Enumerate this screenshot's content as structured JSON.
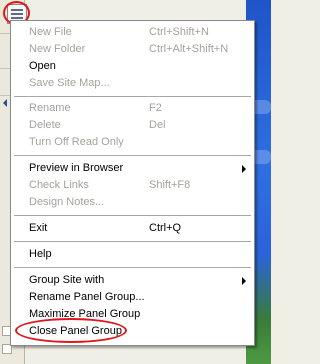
{
  "menu": {
    "items": [
      {
        "label": "New File",
        "shortcut": "Ctrl+Shift+N",
        "enabled": false,
        "submenu": false
      },
      {
        "label": "New Folder",
        "shortcut": "Ctrl+Alt+Shift+N",
        "enabled": false,
        "submenu": false
      },
      {
        "label": "Open",
        "shortcut": "",
        "enabled": true,
        "submenu": false
      },
      {
        "label": "Save Site Map...",
        "shortcut": "",
        "enabled": false,
        "submenu": false
      },
      {
        "label": "Rename",
        "shortcut": "F2",
        "enabled": false,
        "submenu": false
      },
      {
        "label": "Delete",
        "shortcut": "Del",
        "enabled": false,
        "submenu": false
      },
      {
        "label": "Turn Off Read Only",
        "shortcut": "",
        "enabled": false,
        "submenu": false
      },
      {
        "label": "Preview in Browser",
        "shortcut": "",
        "enabled": true,
        "submenu": true
      },
      {
        "label": "Check Links",
        "shortcut": "Shift+F8",
        "enabled": false,
        "submenu": false
      },
      {
        "label": "Design Notes...",
        "shortcut": "",
        "enabled": false,
        "submenu": false
      },
      {
        "label": "Exit",
        "shortcut": "Ctrl+Q",
        "enabled": true,
        "submenu": false
      },
      {
        "label": "Help",
        "shortcut": "",
        "enabled": true,
        "submenu": false
      },
      {
        "label": "Group Site with",
        "shortcut": "",
        "enabled": true,
        "submenu": true
      },
      {
        "label": "Rename Panel Group...",
        "shortcut": "",
        "enabled": true,
        "submenu": false
      },
      {
        "label": "Maximize Panel Group",
        "shortcut": "",
        "enabled": true,
        "submenu": false
      },
      {
        "label": "Close Panel Group",
        "shortcut": "",
        "enabled": true,
        "submenu": false
      }
    ]
  },
  "colors": {
    "highlight_circle": "#e0161c",
    "disabled_text": "#a4a29a",
    "menu_background": "#ffffff"
  },
  "icons": {
    "options_menu": "options-menu-icon",
    "submenu": "submenu-arrow-icon"
  }
}
